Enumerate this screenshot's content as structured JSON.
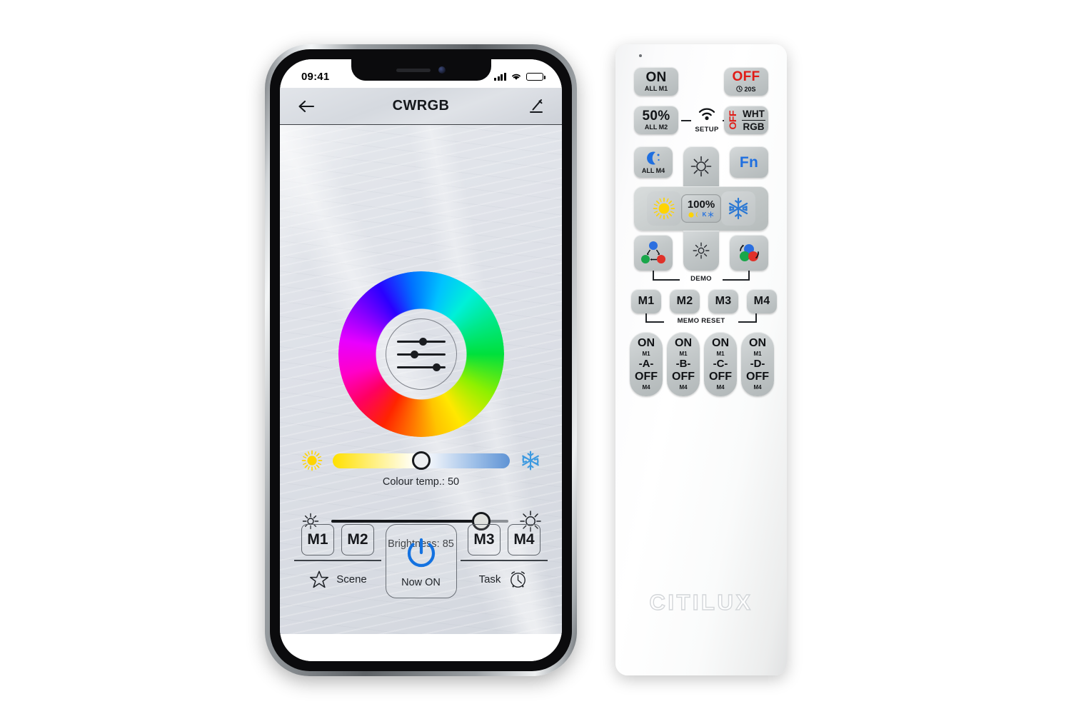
{
  "phone": {
    "status_bar": {
      "time": "09:41",
      "signal_icon": "cellular-bars-icon",
      "wifi_icon": "wifi-icon",
      "battery_icon": "battery-full-icon"
    },
    "nav": {
      "back_icon": "back-arrow-icon",
      "title": "CWRGB",
      "edit_icon": "pencil-edit-icon"
    },
    "colour_wheel": {
      "name": "colour-wheel",
      "center_icon": "sliders-equalizer-icon"
    },
    "colour_temp": {
      "label": "Colour temp.: 50",
      "value": 50,
      "left_icon": "warm-sun-icon",
      "right_icon": "snowflake-icon",
      "gradient_warm": "#ffe000",
      "gradient_cool": "#5f93d4"
    },
    "brightness": {
      "label": "Brightness: 85",
      "value": 85,
      "left_icon": "small-sun-icon",
      "right_icon": "large-sun-icon"
    },
    "bottom": {
      "memory_left": [
        "M1",
        "M2"
      ],
      "memory_right": [
        "M3",
        "M4"
      ],
      "power_label": "Now ON",
      "power_icon": "power-icon",
      "power_color": "#1472e0",
      "scene_icon": "star-icon",
      "scene_label": "Scene",
      "task_label": "Task",
      "task_icon": "alarm-clock-icon"
    }
  },
  "remote": {
    "brand": "CITILUX",
    "row1": [
      {
        "name": "on-all-m1-button",
        "top": "ON",
        "sub": "ALL M1"
      },
      {
        "name": "off-timer-button",
        "top": "OFF",
        "sub": "20S",
        "icon": "clock-icon"
      }
    ],
    "row2": {
      "left": {
        "name": "fifty-percent-all-m2-button",
        "top": "50%",
        "sub": "ALL M2"
      },
      "setup": {
        "label": "SETUP",
        "icon": "wifi-setup-icon"
      },
      "right": {
        "name": "wht-rgb-button",
        "vertical": "OFF",
        "line1": "WHT",
        "line2": "RGB"
      }
    },
    "row3": {
      "moon": {
        "name": "night-all-m4-button",
        "icon": "moon-icon",
        "sub": "ALL M4"
      },
      "up": {
        "name": "brightness-up-button",
        "icon": "bright-sun-icon"
      },
      "fn": {
        "name": "fn-button",
        "label": "Fn"
      }
    },
    "dpad": {
      "left": {
        "name": "warm-white-button",
        "icon": "warm-sun-icon"
      },
      "center": {
        "name": "hundred-percent-button",
        "label": "100%",
        "icons": "dot-k-snowflake-icon"
      },
      "right": {
        "name": "cool-white-button",
        "icon": "snowflake-icon"
      },
      "down": {
        "name": "brightness-down-button",
        "icon": "dim-sun-icon"
      }
    },
    "demo": {
      "label": "DEMO",
      "left": {
        "name": "demo-jump-button",
        "icon": "rgb-jump-icon"
      },
      "right": {
        "name": "demo-fade-button",
        "icon": "rgb-fade-icon"
      }
    },
    "memo": {
      "buttons": [
        "M1",
        "M2",
        "M3",
        "M4"
      ],
      "label": "MEMO RESET"
    },
    "zones": [
      {
        "name": "zone-a",
        "on": "ON",
        "on_sub": "M1",
        "mid": "-A-",
        "off": "OFF",
        "off_sub": "M4"
      },
      {
        "name": "zone-b",
        "on": "ON",
        "on_sub": "M1",
        "mid": "-B-",
        "off": "OFF",
        "off_sub": "M4"
      },
      {
        "name": "zone-c",
        "on": "ON",
        "on_sub": "M1",
        "mid": "-C-",
        "off": "OFF",
        "off_sub": "M4"
      },
      {
        "name": "zone-d",
        "on": "ON",
        "on_sub": "M1",
        "mid": "-D-",
        "off": "OFF",
        "off_sub": "M4"
      }
    ]
  }
}
